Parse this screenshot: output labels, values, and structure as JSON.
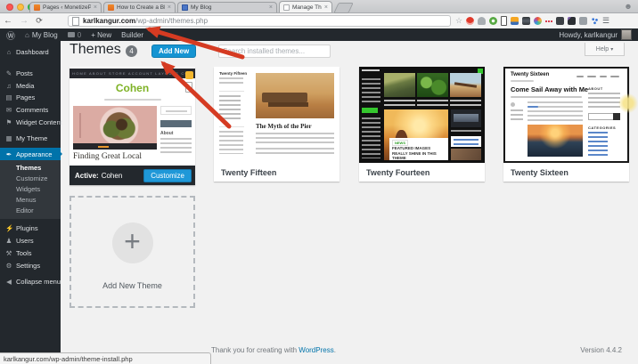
{
  "browser": {
    "tabs": [
      {
        "title": "Pages ‹ MonetizePros — W",
        "close": "×"
      },
      {
        "title": "How to Create a Blog and",
        "close": "×"
      },
      {
        "title": "My Blog",
        "close": "×"
      },
      {
        "title": "Manage Themes ‹ My Blog",
        "close": "×"
      }
    ],
    "url_host": "karlkangur.com",
    "url_path": "/wp-admin/themes.php",
    "status_link": "karlkangur.com/wp-admin/theme-install.php"
  },
  "admin_bar": {
    "wp_icon": "Ⓦ",
    "home_icon": "⌂",
    "site_name": "My Blog",
    "comment_count": "0",
    "new_label": "+ New",
    "builder_label": "Builder",
    "howdy": "Howdy, karlkangur"
  },
  "sidebar": {
    "items": [
      {
        "icon": "⌂",
        "label": "Dashboard"
      },
      {
        "icon": "✎",
        "label": "Posts"
      },
      {
        "icon": "♫",
        "label": "Media"
      },
      {
        "icon": "▤",
        "label": "Pages"
      },
      {
        "icon": "✉",
        "label": "Comments"
      },
      {
        "icon": "⚑",
        "label": "Widget Content"
      },
      {
        "icon": "▦",
        "label": "My Theme"
      },
      {
        "icon": "✒",
        "label": "Appearance"
      },
      {
        "icon": "⚡",
        "label": "Plugins"
      },
      {
        "icon": "♟",
        "label": "Users"
      },
      {
        "icon": "⚒",
        "label": "Tools"
      },
      {
        "icon": "⚙",
        "label": "Settings"
      },
      {
        "icon": "◀",
        "label": "Collapse menu"
      }
    ],
    "submenu": [
      "Themes",
      "Customize",
      "Widgets",
      "Menus",
      "Editor"
    ]
  },
  "main": {
    "title": "Themes",
    "count": "4",
    "add_new_label": "Add New",
    "search_placeholder": "Search installed themes...",
    "help_label": "Help",
    "themes": [
      {
        "name": "Cohen",
        "active_prefix": "Active:",
        "customize_label": "Customize",
        "preview": {
          "nav": "HOME ABOUT STORE ACCOUNT LAYOUTS CON",
          "logo": "Cohen",
          "headline": "Finding Great Local",
          "sidebar_heading": "About"
        }
      },
      {
        "name": "Twenty Fifteen",
        "preview": {
          "site_title": "Twenty Fifteen",
          "headline": "The Myth of the Pier"
        }
      },
      {
        "name": "Twenty Fourteen",
        "preview": {
          "badge": "NEWS",
          "headline": "FEATURED IMAGES REALLY SHINE IN THIS THEME"
        }
      },
      {
        "name": "Twenty Sixteen",
        "preview": {
          "site_title": "Twenty Sixteen",
          "headline": "Come Sail Away with Me",
          "sidebar_heading": "ABOUT",
          "categories_heading": "CATEGORIES"
        }
      }
    ],
    "add_new_theme_label": "Add New Theme",
    "footer": {
      "text": "Thank you for creating with",
      "link": "WordPress",
      "suffix": "."
    },
    "version": "Version 4.4.2"
  },
  "colors": {
    "admin_dark": "#23282d",
    "menu_highlight": "#0073aa",
    "button_blue": "#1594d2",
    "arrow_red": "#d53b22",
    "twentyfourteen_green": "#35c72e"
  }
}
